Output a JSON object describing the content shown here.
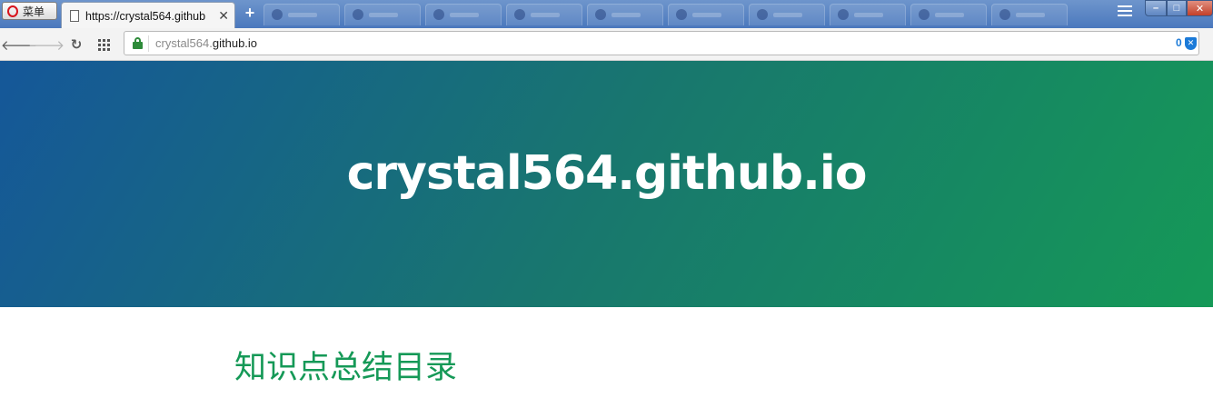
{
  "browser": {
    "menu_label": "菜单",
    "active_tab_title": "https://crystal564.github",
    "new_tab_glyph": "+",
    "tab_close_glyph": "✕",
    "ghost_tab_count": 10,
    "window_controls": {
      "minimize": "–",
      "maximize": "□",
      "close": "✕"
    }
  },
  "toolbar": {
    "back_glyph": "🡐",
    "forward_glyph": "🡒",
    "reload_glyph": "↻",
    "url_host_faded": "crystal564.",
    "url_host": "github.io",
    "adblock_count": "0",
    "adblock_glyph": "✕"
  },
  "page": {
    "hero_title": "crystal564.github.io",
    "section_heading": "知识点总结目录"
  },
  "colors": {
    "hero_gradient_start": "#155799",
    "hero_gradient_end": "#159957",
    "heading_green": "#159957",
    "lock_green": "#2e8b3a",
    "adblock_blue": "#1b7ad8"
  }
}
